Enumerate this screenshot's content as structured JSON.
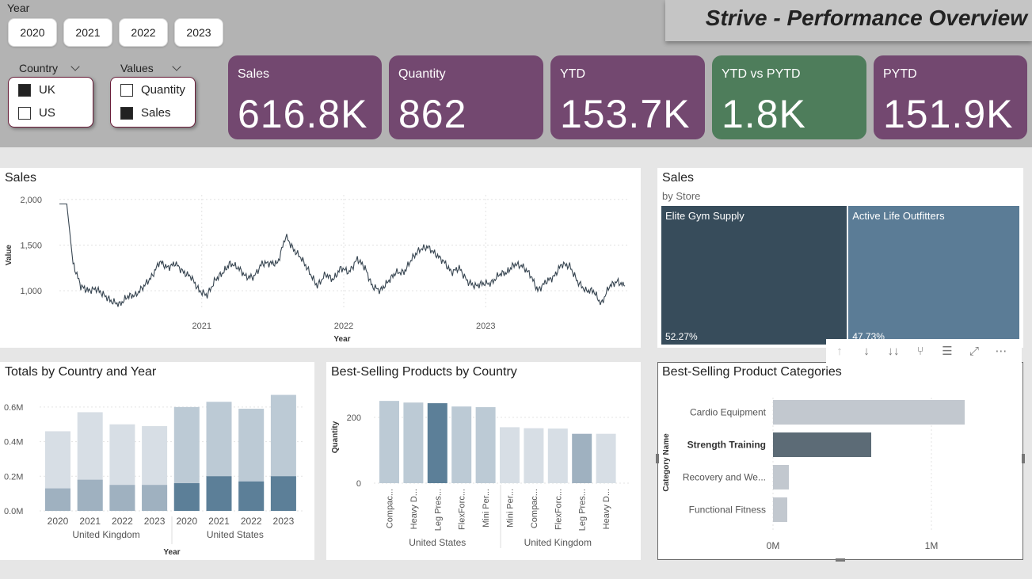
{
  "header": {
    "title": "Strive - Performance Overview",
    "year_label": "Year",
    "years": [
      "2020",
      "2021",
      "2022",
      "2023"
    ]
  },
  "slicers": {
    "country": {
      "label": "Country",
      "items": [
        {
          "label": "UK",
          "checked": true
        },
        {
          "label": "US",
          "checked": false
        }
      ]
    },
    "values": {
      "label": "Values",
      "items": [
        {
          "label": "Quantity",
          "checked": false
        },
        {
          "label": "Sales",
          "checked": true
        }
      ]
    }
  },
  "kpis": [
    {
      "label": "Sales",
      "value": "616.8K",
      "color": "#734870"
    },
    {
      "label": "Quantity",
      "value": "862",
      "color": "#734870"
    },
    {
      "label": "YTD",
      "value": "153.7K",
      "color": "#734870"
    },
    {
      "label": "YTD vs PYTD",
      "value": "1.8K",
      "color": "#4e7d5b"
    },
    {
      "label": "PYTD",
      "value": "151.9K",
      "color": "#734870"
    }
  ],
  "sales_line": {
    "title": "Sales",
    "chart_data": {
      "type": "line",
      "title": "Sales",
      "xlabel": "Year",
      "ylabel": "Value",
      "ylim": [
        800,
        2050
      ],
      "y_ticks": [
        "1,000",
        "1,500",
        "2,000"
      ],
      "x_ticks": [
        "2021",
        "2022",
        "2023"
      ],
      "x_ticks_dates": [
        "2021-01-01",
        "2022-01-01",
        "2023-01-01"
      ],
      "x_range_dates": [
        "2020-01-01",
        "2023-12-31"
      ],
      "series": [
        {
          "color": "#374551",
          "x": [
            "2020-01-01",
            "2020-01-20",
            "2020-02-05",
            "2020-02-25",
            "2020-03-15",
            "2020-04-05",
            "2020-04-25",
            "2020-05-15",
            "2020-06-05",
            "2020-06-25",
            "2020-07-15",
            "2020-08-05",
            "2020-08-25",
            "2020-09-15",
            "2020-10-05",
            "2020-10-25",
            "2020-11-15",
            "2020-12-05",
            "2020-12-25",
            "2021-01-15",
            "2021-02-05",
            "2021-02-25",
            "2021-03-15",
            "2021-04-05",
            "2021-04-25",
            "2021-05-15",
            "2021-06-05",
            "2021-06-25",
            "2021-07-15",
            "2021-08-05",
            "2021-08-25",
            "2021-09-15",
            "2021-10-05",
            "2021-10-25",
            "2021-11-15",
            "2021-12-05",
            "2021-12-25",
            "2022-01-15",
            "2022-02-05",
            "2022-02-25",
            "2022-03-15",
            "2022-04-05",
            "2022-04-25",
            "2022-05-15",
            "2022-06-05",
            "2022-06-25",
            "2022-07-15",
            "2022-08-05",
            "2022-08-25",
            "2022-09-15",
            "2022-10-05",
            "2022-10-25",
            "2022-11-15",
            "2022-12-05",
            "2022-12-25",
            "2023-01-15",
            "2023-02-05",
            "2023-02-25",
            "2023-03-15",
            "2023-04-05",
            "2023-04-25",
            "2023-05-15",
            "2023-06-05",
            "2023-06-25",
            "2023-07-15",
            "2023-08-05",
            "2023-08-25",
            "2023-09-15",
            "2023-10-05",
            "2023-10-25",
            "2023-11-15",
            "2023-12-05",
            "2023-12-25"
          ],
          "y": [
            1950,
            1950,
            1300,
            1050,
            1000,
            1020,
            950,
            880,
            850,
            940,
            950,
            1050,
            1150,
            1320,
            1250,
            1300,
            1200,
            1150,
            1000,
            950,
            1120,
            1200,
            1300,
            1250,
            1150,
            1150,
            1300,
            1300,
            1300,
            1600,
            1450,
            1350,
            1200,
            1050,
            1180,
            1120,
            1250,
            1200,
            1350,
            1250,
            1050,
            1000,
            1100,
            1200,
            1200,
            1350,
            1450,
            1480,
            1400,
            1320,
            1200,
            1250,
            1100,
            1050,
            1080,
            1080,
            1180,
            1200,
            1290,
            1270,
            1180,
            1000,
            1100,
            1150,
            1290,
            1270,
            1100,
            1000,
            1000,
            850,
            1050,
            1100,
            1050
          ]
        }
      ]
    }
  },
  "treemap": {
    "title": "Sales",
    "subtitle": "by Store",
    "chart_data": {
      "type": "treemap",
      "title": "Sales",
      "subtitle": "by Store",
      "items": [
        {
          "label": "Elite Gym Supply",
          "value": 52.27,
          "display": "52.27%",
          "color": "#374c5b"
        },
        {
          "label": "Active Life Outfitters",
          "value": 47.73,
          "display": "47.73%",
          "color": "#5b7c96"
        }
      ]
    }
  },
  "totals_bar": {
    "title": "Totals by Country and Year",
    "chart_data": {
      "type": "bar",
      "title": "Totals by Country and Year",
      "xlabel": "Year",
      "ylim": [
        0,
        0.7
      ],
      "y_ticks": [
        "0.0M",
        "0.2M",
        "0.4M",
        "0.6M"
      ],
      "y_tick_values": [
        0,
        0.2,
        0.4,
        0.6
      ],
      "categories": [
        "2020",
        "2021",
        "2022",
        "2023",
        "2020",
        "2021",
        "2022",
        "2023"
      ],
      "groups": [
        {
          "label": "United Kingdom",
          "start": 0,
          "end": 3
        },
        {
          "label": "United States",
          "start": 4,
          "end": 7
        }
      ],
      "totals": [
        0.46,
        0.57,
        0.5,
        0.49,
        0.6,
        0.63,
        0.59,
        0.67
      ],
      "lower": [
        0.13,
        0.18,
        0.15,
        0.15,
        0.16,
        0.2,
        0.17,
        0.2
      ],
      "colors_top": [
        "#d7dee5",
        "#d7dee5",
        "#d7dee5",
        "#d7dee5",
        "#bccad5",
        "#bccad5",
        "#bccad5",
        "#bccad5"
      ],
      "colors_low": [
        "#9fb1c0",
        "#9fb1c0",
        "#9fb1c0",
        "#9fb1c0",
        "#5c7f98",
        "#5c7f98",
        "#5c7f98",
        "#5c7f98"
      ]
    }
  },
  "best_products": {
    "title": "Best-Selling Products by Country",
    "chart_data": {
      "type": "bar",
      "title": "Best-Selling Products by Country",
      "ylabel": "Quantity",
      "ylim": [
        0,
        260
      ],
      "y_ticks": [
        "0",
        "200"
      ],
      "y_tick_values": [
        0,
        200
      ],
      "categories": [
        "Compac...",
        "Heavy D...",
        "Leg Pres...",
        "FlexForc...",
        "Mini Per...",
        "Mini Per...",
        "Compac...",
        "FlexForc...",
        "Leg Pres...",
        "Heavy D..."
      ],
      "values": [
        250,
        245,
        243,
        233,
        231,
        170,
        167,
        166,
        150,
        150
      ],
      "colors": [
        "#bccad5",
        "#bccad5",
        "#5c7f98",
        "#bccad5",
        "#bccad5",
        "#d7dee5",
        "#d7dee5",
        "#d7dee5",
        "#9fb1c0",
        "#d7dee5"
      ],
      "groups": [
        {
          "label": "United States",
          "start": 0,
          "end": 4
        },
        {
          "label": "United Kingdom",
          "start": 5,
          "end": 9
        }
      ]
    }
  },
  "categories_bar": {
    "title": "Best-Selling Product Categories",
    "chart_data": {
      "type": "bar",
      "orientation": "horizontal",
      "title": "Best-Selling Product Categories",
      "ylabel": "Category Name",
      "xlim": [
        0,
        1.5
      ],
      "x_ticks": [
        "0M",
        "1M"
      ],
      "x_tick_values": [
        0,
        1
      ],
      "categories": [
        "Cardio Equipment",
        "Strength Training",
        "Recovery and We...",
        "Functional Fitness"
      ],
      "values": [
        1.21,
        0.62,
        0.1,
        0.09
      ],
      "bold": [
        false,
        true,
        false,
        false
      ],
      "colors": [
        "#c2c8cf",
        "#5c6b76",
        "#c2c8cf",
        "#c2c8cf"
      ]
    }
  },
  "toolbar": {
    "icons": [
      "arrow-up-icon",
      "arrow-down-icon",
      "double-arrow-down-icon",
      "expand-hierarchy-icon",
      "filter-icon",
      "focus-mode-icon",
      "more-options-icon"
    ],
    "glyphs": [
      "↑",
      "↓",
      "↓↓",
      "⑂",
      "☰",
      "⤢",
      "⋯"
    ]
  }
}
